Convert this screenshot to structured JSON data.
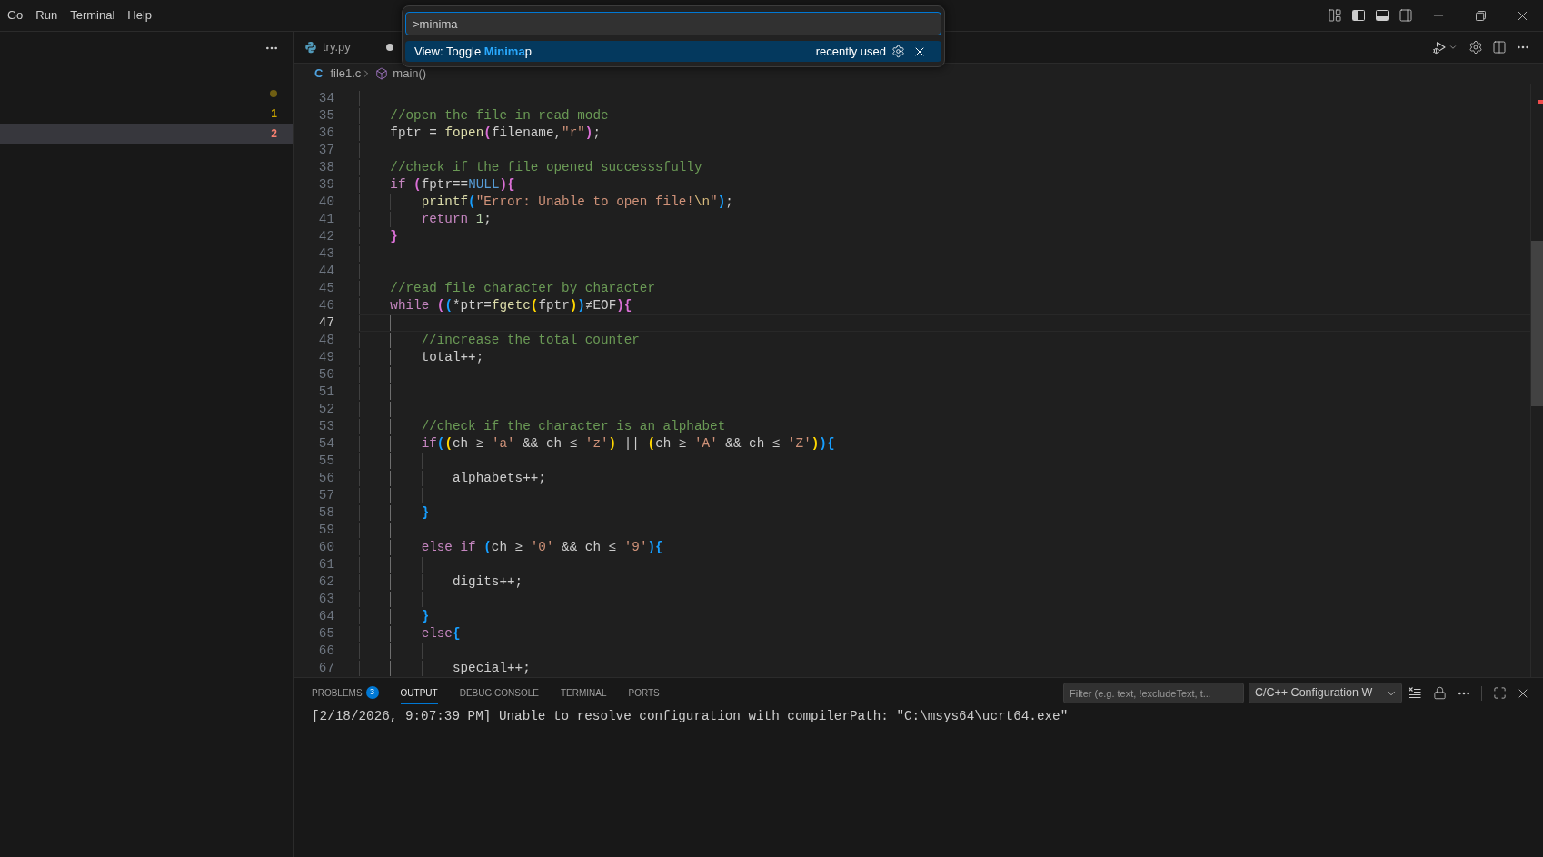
{
  "menu": [
    {
      "label": "Go"
    },
    {
      "label": "Run"
    },
    {
      "label": "Terminal"
    },
    {
      "label": "Help"
    }
  ],
  "command_palette": {
    "value": ">minima",
    "results": [
      {
        "label": "View: Toggle **Minima**p",
        "detail": "recently used",
        "selected": true
      }
    ]
  },
  "sidebar": {
    "items": [
      {
        "kind": "dot",
        "color": "#6f5e13",
        "selected": false
      },
      {
        "kind": "count",
        "badge": "1",
        "color": "#cca700",
        "selected": false
      },
      {
        "kind": "count",
        "badge": "2",
        "color": "#f88070",
        "selected": true
      }
    ]
  },
  "tabs": [
    {
      "label": "try.py",
      "modified": true,
      "selected": false
    }
  ],
  "breadcrumb": {
    "file_glyph": "C",
    "file": "file1.c",
    "symbol": "main()"
  },
  "editor": {
    "lines": [
      {
        "number": "34",
        "current": false
      },
      {
        "number": "35",
        "current": false,
        "tokens": [
          {
            "text": "    //open the file in read mode",
            "kind": "comment"
          }
        ]
      },
      {
        "number": "36",
        "current": false,
        "tokens": [
          {
            "text": "    fptr = ",
            "kind": "text"
          },
          {
            "text": "fopen",
            "kind": "function"
          },
          {
            "text": "(",
            "kind": "bracket",
            "color": "#da70d6"
          },
          {
            "text": "filename,",
            "kind": "text"
          },
          {
            "text": "\"r\"",
            "kind": "string"
          },
          {
            "text": ")",
            "kind": "bracket",
            "color": "#da70d6"
          },
          {
            "text": ";",
            "kind": "text"
          }
        ]
      },
      {
        "number": "37",
        "current": false
      },
      {
        "number": "38",
        "current": false,
        "tokens": [
          {
            "text": "    //check if the file opened successsfully",
            "kind": "comment"
          }
        ]
      },
      {
        "number": "39",
        "current": false,
        "tokens": [
          {
            "text": "    if ",
            "kind": "keyword"
          },
          {
            "text": "(",
            "kind": "bracket",
            "color": "#da70d6"
          },
          {
            "text": "fptr==",
            "kind": "text"
          },
          {
            "text": "NULL",
            "kind": "constant"
          },
          {
            "text": ")",
            "kind": "bracket",
            "color": "#da70d6"
          },
          {
            "text": "{",
            "kind": "bracket",
            "color": "#da70d6"
          }
        ]
      },
      {
        "number": "40",
        "current": false,
        "tokens": [
          {
            "text": "        printf",
            "kind": "function"
          },
          {
            "text": "(",
            "kind": "bracket",
            "color": "#179fff"
          },
          {
            "text": "\"Error: Unable to open file!",
            "kind": "string"
          },
          {
            "text": "\\n",
            "kind": "escape"
          },
          {
            "text": "\"",
            "kind": "string"
          },
          {
            "text": ")",
            "kind": "bracket",
            "color": "#179fff"
          },
          {
            "text": ";",
            "kind": "text"
          }
        ]
      },
      {
        "number": "41",
        "current": false,
        "tokens": [
          {
            "text": "        return ",
            "kind": "keyword"
          },
          {
            "text": "1",
            "kind": "number"
          },
          {
            "text": ";",
            "kind": "text"
          }
        ]
      },
      {
        "number": "42",
        "current": false,
        "tokens": [
          {
            "text": "    }",
            "kind": "bracket",
            "color": "#da70d6"
          }
        ]
      },
      {
        "number": "43",
        "current": false
      },
      {
        "number": "44",
        "current": false
      },
      {
        "number": "45",
        "current": false,
        "tokens": [
          {
            "text": "    //read file character by character",
            "kind": "comment"
          }
        ]
      },
      {
        "number": "46",
        "current": false,
        "tokens": [
          {
            "text": "    while ",
            "kind": "keyword"
          },
          {
            "text": "(",
            "kind": "bracket",
            "color": "#da70d6"
          },
          {
            "text": "(",
            "kind": "bracket",
            "color": "#179fff"
          },
          {
            "text": "*ptr=",
            "kind": "text"
          },
          {
            "text": "fgetc",
            "kind": "function"
          },
          {
            "text": "(",
            "kind": "bracket",
            "color": "#ffd700"
          },
          {
            "text": "fptr",
            "kind": "text"
          },
          {
            "text": ")",
            "kind": "bracket",
            "color": "#ffd700"
          },
          {
            "text": ")",
            "kind": "bracket",
            "color": "#179fff"
          },
          {
            "text": "≠EOF",
            "kind": "text"
          },
          {
            "text": ")",
            "kind": "bracket",
            "color": "#da70d6"
          },
          {
            "text": "{",
            "kind": "bracket",
            "color": "#da70d6"
          }
        ]
      },
      {
        "number": "47",
        "current": true
      },
      {
        "number": "48",
        "current": false,
        "tokens": [
          {
            "text": "        //increase the total counter",
            "kind": "comment"
          }
        ]
      },
      {
        "number": "49",
        "current": false,
        "tokens": [
          {
            "text": "        total++;",
            "kind": "text"
          }
        ]
      },
      {
        "number": "50",
        "current": false
      },
      {
        "number": "51",
        "current": false
      },
      {
        "number": "52",
        "current": false
      },
      {
        "number": "53",
        "current": false,
        "tokens": [
          {
            "text": "        //check if the character is an alphabet",
            "kind": "comment"
          }
        ]
      },
      {
        "number": "54",
        "current": false,
        "tokens": [
          {
            "text": "        if",
            "kind": "keyword"
          },
          {
            "text": "(",
            "kind": "bracket",
            "color": "#179fff"
          },
          {
            "text": "(",
            "kind": "bracket",
            "color": "#ffd700"
          },
          {
            "text": "ch ≥ ",
            "kind": "text"
          },
          {
            "text": "'a'",
            "kind": "string"
          },
          {
            "text": " && ch ≤ ",
            "kind": "text"
          },
          {
            "text": "'z'",
            "kind": "string"
          },
          {
            "text": ")",
            "kind": "bracket",
            "color": "#ffd700"
          },
          {
            "text": " || ",
            "kind": "text"
          },
          {
            "text": "(",
            "kind": "bracket",
            "color": "#ffd700"
          },
          {
            "text": "ch ≥ ",
            "kind": "text"
          },
          {
            "text": "'A'",
            "kind": "string"
          },
          {
            "text": " && ch ≤ ",
            "kind": "text"
          },
          {
            "text": "'Z'",
            "kind": "string"
          },
          {
            "text": ")",
            "kind": "bracket",
            "color": "#ffd700"
          },
          {
            "text": ")",
            "kind": "bracket",
            "color": "#179fff"
          },
          {
            "text": "{",
            "kind": "bracket",
            "color": "#179fff"
          }
        ]
      },
      {
        "number": "55",
        "current": false
      },
      {
        "number": "56",
        "current": false,
        "tokens": [
          {
            "text": "            alphabets++;",
            "kind": "text"
          }
        ]
      },
      {
        "number": "57",
        "current": false
      },
      {
        "number": "58",
        "current": false,
        "tokens": [
          {
            "text": "        }",
            "kind": "bracket",
            "color": "#179fff"
          }
        ]
      },
      {
        "number": "59",
        "current": false
      },
      {
        "number": "60",
        "current": false,
        "tokens": [
          {
            "text": "        else if ",
            "kind": "keyword"
          },
          {
            "text": "(",
            "kind": "bracket",
            "color": "#179fff"
          },
          {
            "text": "ch ≥ ",
            "kind": "text"
          },
          {
            "text": "'0'",
            "kind": "string"
          },
          {
            "text": " && ch ≤ ",
            "kind": "text"
          },
          {
            "text": "'9'",
            "kind": "string"
          },
          {
            "text": ")",
            "kind": "bracket",
            "color": "#179fff"
          },
          {
            "text": "{",
            "kind": "bracket",
            "color": "#179fff"
          }
        ]
      },
      {
        "number": "61",
        "current": false
      },
      {
        "number": "62",
        "current": false,
        "tokens": [
          {
            "text": "            digits++;",
            "kind": "text"
          }
        ]
      },
      {
        "number": "63",
        "current": false
      },
      {
        "number": "64",
        "current": false,
        "tokens": [
          {
            "text": "        }",
            "kind": "bracket",
            "color": "#179fff"
          }
        ]
      },
      {
        "number": "65",
        "current": false,
        "tokens": [
          {
            "text": "        else",
            "kind": "keyword"
          },
          {
            "text": "{",
            "kind": "bracket",
            "color": "#179fff"
          }
        ]
      },
      {
        "number": "66",
        "current": false
      },
      {
        "number": "67",
        "current": false,
        "tokens": [
          {
            "text": "            special++;",
            "kind": "text"
          }
        ]
      }
    ]
  },
  "panel": {
    "tabs": [
      {
        "label": "PROBLEMS",
        "badge": "3",
        "selected": false
      },
      {
        "label": "OUTPUT",
        "selected": true
      },
      {
        "label": "DEBUG CONSOLE",
        "selected": false
      },
      {
        "label": "TERMINAL",
        "selected": false
      },
      {
        "label": "PORTS",
        "selected": false
      }
    ],
    "filter": {
      "placeholder": "Filter (e.g. text, !excludeText, t..."
    },
    "channel": {
      "value": "C/C++ Configuration W"
    },
    "output": [
      "[2/18/2026, 9:07:39 PM] Unable to resolve configuration with compilerPath: \"C:\\msys64\\ucrt64.exe\""
    ]
  }
}
